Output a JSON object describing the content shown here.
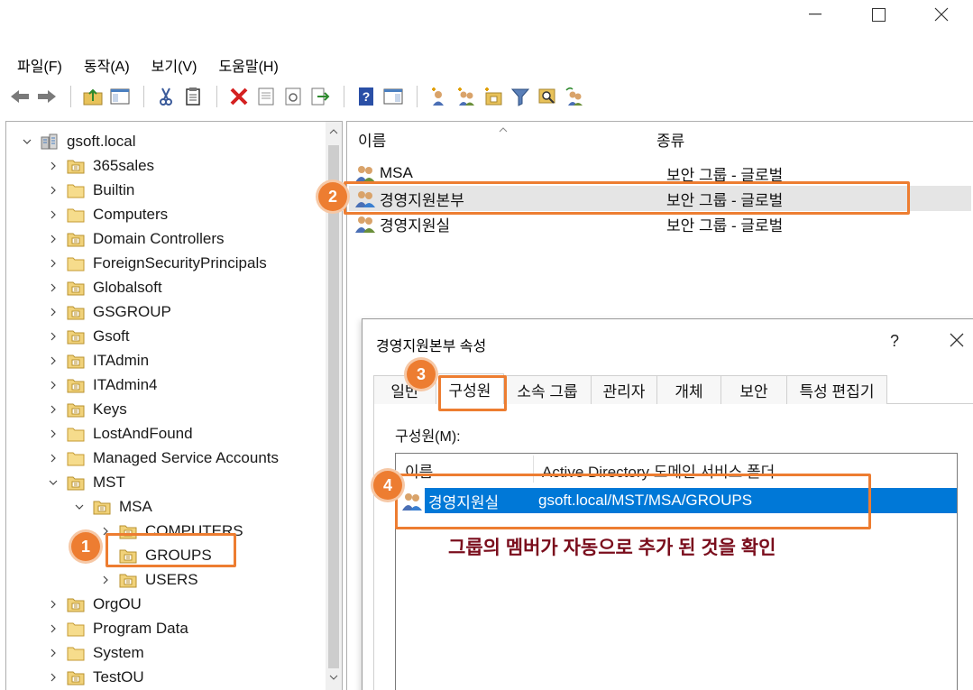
{
  "menubar": {
    "items": [
      "파일(F)",
      "동작(A)",
      "보기(V)",
      "도움말(H)"
    ]
  },
  "toolbar": {
    "icons": [
      "back-arrow",
      "forward-arrow",
      "up-folder",
      "show-tree",
      "cut",
      "copy",
      "delete",
      "properties",
      "refresh",
      "export-list",
      "help",
      "show-pane",
      "add-user",
      "add-group",
      "add-ou",
      "filter",
      "find",
      "add-to-group"
    ]
  },
  "tree": {
    "root": "gsoft.local",
    "items": [
      {
        "label": "365sales"
      },
      {
        "label": "Builtin"
      },
      {
        "label": "Computers"
      },
      {
        "label": "Domain Controllers"
      },
      {
        "label": "ForeignSecurityPrincipals"
      },
      {
        "label": "Globalsoft"
      },
      {
        "label": "GSGROUP"
      },
      {
        "label": "Gsoft"
      },
      {
        "label": "ITAdmin"
      },
      {
        "label": "ITAdmin4"
      },
      {
        "label": "Keys"
      },
      {
        "label": "LostAndFound"
      },
      {
        "label": "Managed Service Accounts"
      },
      {
        "label": "MST"
      },
      {
        "label": "MSA"
      },
      {
        "label": "COMPUTERS"
      },
      {
        "label": "GROUPS"
      },
      {
        "label": "USERS"
      },
      {
        "label": "OrgOU"
      },
      {
        "label": "Program Data"
      },
      {
        "label": "System"
      },
      {
        "label": "TestOU"
      }
    ]
  },
  "list": {
    "col_name": "이름",
    "col_type": "종류",
    "rows": [
      {
        "name": "MSA",
        "type": "보안 그룹 - 글로벌"
      },
      {
        "name": "경영지원본부",
        "type": "보안 그룹 - 글로벌"
      },
      {
        "name": "경영지원실",
        "type": "보안 그룹 - 글로벌"
      }
    ]
  },
  "dialog": {
    "title": "경영지원본부 속성",
    "help": "?",
    "tabs": [
      "일반",
      "구성원",
      "소속 그룹",
      "관리자",
      "개체",
      "보안",
      "특성 편집기"
    ],
    "members_label": "구성원(M):",
    "members_cols": {
      "name": "이름",
      "folder": "Active Directory 도메인 서비스 폴더"
    },
    "member": {
      "name": "경영지원실",
      "folder": "gsoft.local/MST/MSA/GROUPS"
    }
  },
  "annotation": {
    "note": "그룹의 멤버가 자동으로 추가 된 것을 확인",
    "badges": [
      "1",
      "2",
      "3",
      "4"
    ]
  },
  "colors": {
    "accent": "#ed7d31",
    "selection": "#0078d7",
    "note": "#7a0d1c"
  }
}
